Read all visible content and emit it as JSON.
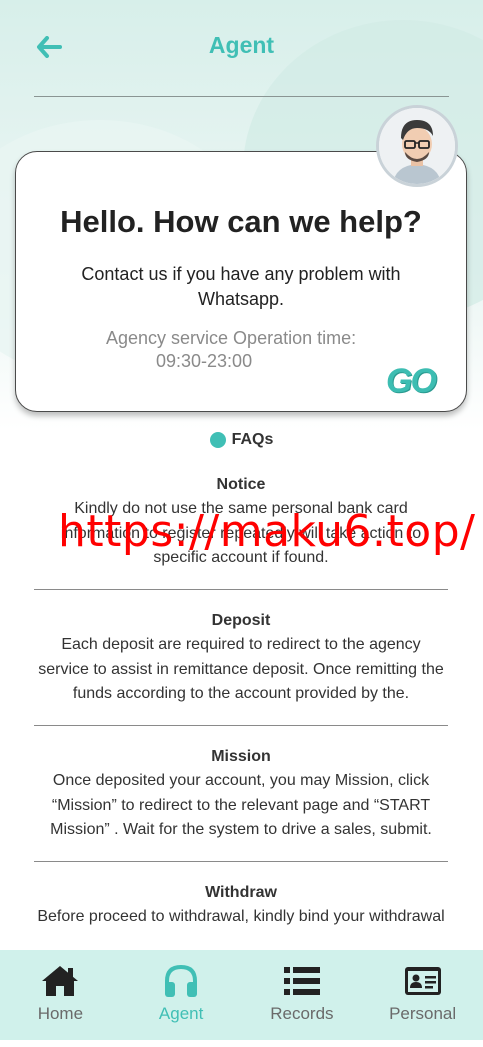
{
  "header": {
    "title": "Agent",
    "back_icon": "arrow-left-icon"
  },
  "card": {
    "title": "Hello. How can we help?",
    "description": "Contact us if you have any problem with Whatsapp.",
    "operation_label": "Agency service Operation time:",
    "operation_time": "09:30-23:00",
    "go_label": "GO"
  },
  "faq": {
    "label": "FAQs",
    "items": [
      {
        "title": "Notice",
        "text": "Kindly do not use the same personal bank card information to register repeatedly will take action to specific account if found."
      },
      {
        "title": "Deposit",
        "text": "Each deposit are required to redirect to the agency service to assist in remittance deposit. Once remitting the funds according to the account provided by the."
      },
      {
        "title": "Mission",
        "text": "Once deposited your account, you may Mission, click “Mission” to redirect to the relevant page and “START Mission” . Wait for the system to drive a sales, submit."
      },
      {
        "title": "Withdraw",
        "text": "Before proceed to withdrawal, kindly bind your withdrawal"
      }
    ]
  },
  "watermark": "https://maku6.top/",
  "tabs": [
    {
      "label": "Home",
      "icon": "home-icon",
      "active": false
    },
    {
      "label": "Agent",
      "icon": "headphones-icon",
      "active": true
    },
    {
      "label": "Records",
      "icon": "list-icon",
      "active": false
    },
    {
      "label": "Personal",
      "icon": "id-card-icon",
      "active": false
    }
  ],
  "colors": {
    "accent": "#40bfb5",
    "tabbar_bg": "#d0f1eb",
    "watermark": "#ff0000"
  }
}
